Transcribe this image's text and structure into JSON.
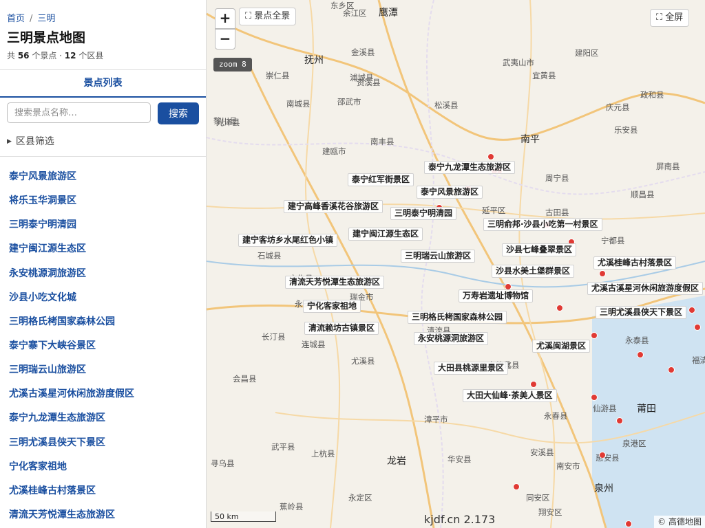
{
  "breadcrumb": {
    "home": "首页",
    "separator": "/",
    "current": "三明"
  },
  "page": {
    "title": "三明景点地图",
    "stats": {
      "prefix": "共 ",
      "spots": "56",
      "mid": " 个景点 · ",
      "districts": "12",
      "suffix": " 个区县"
    }
  },
  "tab": {
    "label": "景点列表"
  },
  "search": {
    "placeholder": "搜索景点名称…",
    "button": "搜索"
  },
  "filter": {
    "label": "区县筛选"
  },
  "spots": [
    "泰宁风景旅游区",
    "将乐玉华洞景区",
    "三明泰宁明清园",
    "建宁闽江源生态区",
    "永安桃源洞旅游区",
    "沙县小吃文化城",
    "三明格氏栲国家森林公园",
    "泰宁寨下大峡谷景区",
    "三明瑞云山旅游区",
    "尤溪古溪星河休闲旅游度假区",
    "泰宁九龙潭生态旅游区",
    "三明尤溪县侠天下景区",
    "宁化客家祖地",
    "尤溪桂峰古村落景区",
    "清流天芳悦潭生态旅游区"
  ],
  "map": {
    "zoom_in": "+",
    "zoom_out": "−",
    "overview": "景点全景",
    "fullscreen": "全屏",
    "zoom_level": "zoom 8",
    "scale": "50 km",
    "watermark": "kjdf.cn 2.173",
    "copyright": "© 高德地图",
    "cities": [
      "鹰潭",
      "抚州",
      "南平",
      "龙岩",
      "莆田",
      "泉州"
    ],
    "places": [
      "东乡区",
      "余江区",
      "金溪县",
      "崇仁县",
      "资溪县",
      "光泽县",
      "浦城县",
      "建阳区",
      "武夷山市",
      "宜黄县",
      "南城县",
      "邵武市",
      "松溪县",
      "庆元县",
      "政和县",
      "乐安县",
      "黎川县",
      "南丰县",
      "建瓯市",
      "周宁县",
      "屏南县",
      "顺昌县",
      "延平区",
      "古田县",
      "宁都县",
      "石城县",
      "宁化县",
      "永安市",
      "清流县",
      "瑞金市",
      "长汀县",
      "连城县",
      "尤溪县",
      "德化县",
      "永泰县",
      "福清市",
      "大田县",
      "会昌县",
      "漳平市",
      "永春县",
      "仙游县",
      "武平县",
      "上杭县",
      "华安县",
      "安溪县",
      "泉港区",
      "寻乌县",
      "永定区",
      "南安市",
      "惠安县",
      "蕉岭县",
      "同安区",
      "翔安区"
    ],
    "markers": [
      {
        "lat": 26.95,
        "lng": 117.15
      },
      {
        "lat": 26.88,
        "lng": 117.2
      },
      {
        "lat": 26.88,
        "lng": 117.17
      },
      {
        "lat": 26.8,
        "lng": 117.02
      },
      {
        "lat": 26.71,
        "lng": 116.85
      },
      {
        "lat": 26.63,
        "lng": 117.48
      },
      {
        "lat": 26.55,
        "lng": 117.62
      },
      {
        "lat": 26.4,
        "lng": 117.8
      },
      {
        "lat": 26.34,
        "lng": 117.25
      },
      {
        "lat": 26.24,
        "lng": 117.55
      },
      {
        "lat": 26.23,
        "lng": 118.32
      },
      {
        "lat": 26.15,
        "lng": 118.35
      },
      {
        "lat": 26.11,
        "lng": 117.75
      },
      {
        "lat": 26.02,
        "lng": 118.02
      },
      {
        "lat": 25.95,
        "lng": 118.2
      },
      {
        "lat": 25.88,
        "lng": 117.4
      },
      {
        "lat": 25.82,
        "lng": 117.75
      },
      {
        "lat": 25.71,
        "lng": 117.9
      },
      {
        "lat": 25.55,
        "lng": 117.8
      },
      {
        "lat": 25.4,
        "lng": 117.3
      },
      {
        "lat": 25.1,
        "lng": 117.95
      }
    ],
    "labels": [
      "泰宁九龙潭生态旅游区",
      "泰宁红军街景区",
      "泰宁风景旅游区",
      "建宁高峰香溪花谷旅游区",
      "三明泰宁明清园",
      "三明俞邦·沙县小吃第一村景区",
      "建宁闽江源生态区",
      "建宁客坊乡水尾红色小镇",
      "沙县七峰叠翠景区",
      "三明瑞云山旅游区",
      "尤溪桂峰古村落景区",
      "沙县水美土堡群景区",
      "清流天芳悦潭生态旅游区",
      "尤溪古溪星河休闲旅游度假区",
      "万寿岩遗址博物馆",
      "宁化客家祖地",
      "三明尤溪县侠天下景区",
      "三明格氏栲国家森林公园",
      "清流赖坊古镇景区",
      "永安桃源洞旅游区",
      "尤溪闽湖景区",
      "大田县桃源里景区",
      "大田大仙峰·茶美人景区"
    ]
  }
}
